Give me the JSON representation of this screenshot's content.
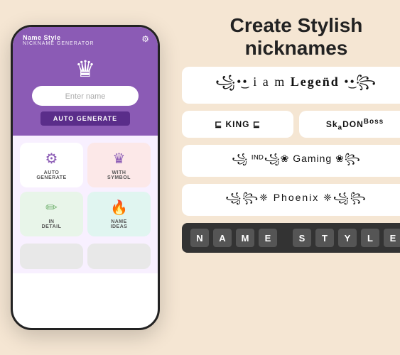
{
  "app": {
    "name": "Name Style",
    "subtitle": "NICKNAME GENERATOR"
  },
  "phone": {
    "input_placeholder": "Enter name",
    "auto_generate_label": "AUTO GENERATE"
  },
  "features": [
    {
      "id": "auto-generate",
      "label": "AUTO\nGENERATE",
      "icon": "⚙",
      "bg": "default"
    },
    {
      "id": "with-symbol",
      "label": "WITH\nSYMBOL",
      "icon": "♛",
      "bg": "pink"
    },
    {
      "id": "in-detail",
      "label": "IN\nDETAIL",
      "icon": "✏",
      "bg": "green"
    },
    {
      "id": "name-ideas",
      "label": "NAME\nIDEAS",
      "icon": "🔥",
      "bg": "teal"
    }
  ],
  "title": {
    "line1": "Create Stylish",
    "line2": "nicknames"
  },
  "style_examples": [
    {
      "id": "legend",
      "text": "꧁•͜• iam Legend •͜•꧂",
      "style": "legend-style"
    },
    {
      "id": "king",
      "text": "⊑ KING ⊑",
      "style": ""
    },
    {
      "id": "skadon",
      "text": "SkₐDONᴮᵒˢˢ",
      "style": ""
    },
    {
      "id": "gaming",
      "text": "꧁ᴵᴺᴰ꧁❀Gaming꧂",
      "style": "gaming-style"
    },
    {
      "id": "phoenix",
      "text": "꧁꧂❈Phoenix❈꧁꧂",
      "style": "phoenix-style"
    }
  ],
  "name_style_bar": {
    "letters": [
      "N",
      "A",
      "M",
      "E",
      "",
      "S",
      "T",
      "Y",
      "L",
      "E"
    ]
  }
}
